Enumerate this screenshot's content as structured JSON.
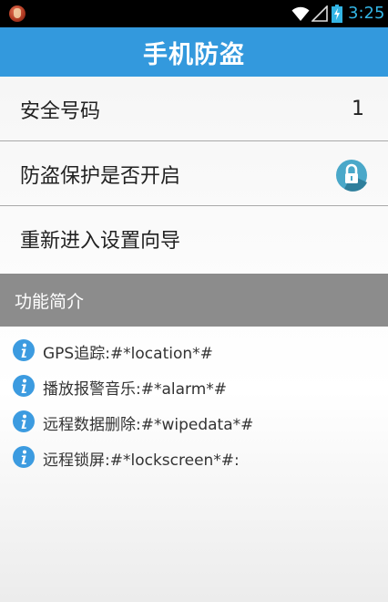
{
  "status_bar": {
    "time": "3:25",
    "time_color": "#33b5e5"
  },
  "title_bar": {
    "title": "手机防盗",
    "color": "#3399dd"
  },
  "settings": {
    "safe_number_label": "安全号码",
    "safe_number_value": "1",
    "protection_label": "防盗保护是否开启",
    "protection_icon": "lock-icon",
    "reenter_wizard_label": "重新进入设置向导"
  },
  "intro": {
    "header": "功能简介",
    "items": [
      {
        "icon": "info-icon",
        "text": "GPS追踪:#*location*#"
      },
      {
        "icon": "info-icon",
        "text": "播放报警音乐:#*alarm*#"
      },
      {
        "icon": "info-icon",
        "text": "远程数据删除:#*wipedata*#"
      },
      {
        "icon": "info-icon",
        "text": "远程锁屏:#*lockscreen*#:"
      }
    ]
  }
}
